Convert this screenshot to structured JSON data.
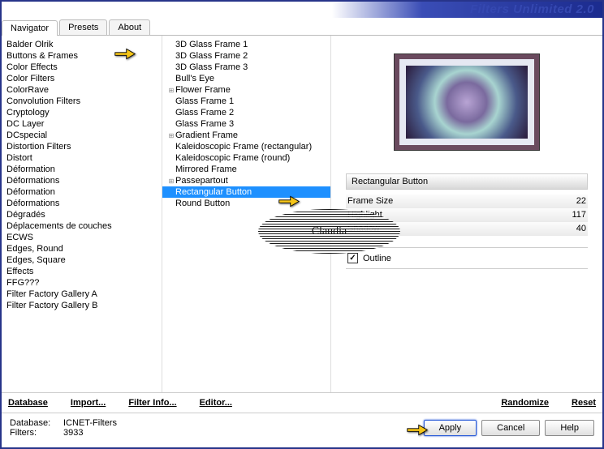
{
  "title": "Filters Unlimited 2.0",
  "tabs": [
    "Navigator",
    "Presets",
    "About"
  ],
  "categories": [
    "Balder Olrik",
    "Buttons & Frames",
    "Color Effects",
    "Color Filters",
    "ColorRave",
    "Convolution Filters",
    "Cryptology",
    "DC Layer",
    "DCspecial",
    "Distortion Filters",
    "Distort",
    "Déformation",
    "Déformations",
    "Déformation",
    "Déformations",
    "Dégradés",
    "Déplacements de couches",
    "ECWS",
    "Edges, Round",
    "Edges, Square",
    "Effects",
    "FFG???",
    "Filter Factory Gallery A",
    "Filter Factory Gallery B"
  ],
  "filters": [
    {
      "n": "3D Glass Frame 1",
      "g": 0
    },
    {
      "n": "3D Glass Frame 2",
      "g": 0
    },
    {
      "n": "3D Glass Frame 3",
      "g": 0
    },
    {
      "n": "Bull's Eye",
      "g": 0
    },
    {
      "n": "Flower Frame",
      "g": 1
    },
    {
      "n": "Glass Frame 1",
      "g": 0
    },
    {
      "n": "Glass Frame 2",
      "g": 0
    },
    {
      "n": "Glass Frame 3",
      "g": 0
    },
    {
      "n": "Gradient Frame",
      "g": 1
    },
    {
      "n": "Kaleidoscopic Frame (rectangular)",
      "g": 0
    },
    {
      "n": "Kaleidoscopic Frame (round)",
      "g": 0
    },
    {
      "n": "Mirrored Frame",
      "g": 0
    },
    {
      "n": "Passepartout",
      "g": 1
    },
    {
      "n": "Rectangular Button",
      "g": 0,
      "sel": 1
    },
    {
      "n": "Round Button",
      "g": 0
    }
  ],
  "selected_filter_name": "Rectangular Button",
  "sliders": [
    {
      "label": "Frame Size",
      "value": "22"
    },
    {
      "label": "Highlight",
      "value": "117"
    },
    {
      "label": "Shadow",
      "value": "40"
    }
  ],
  "checkbox": {
    "label": "Outline",
    "checked": true
  },
  "links": {
    "database": "Database",
    "import": "Import...",
    "filterinfo": "Filter Info...",
    "editor": "Editor...",
    "randomize": "Randomize",
    "reset": "Reset"
  },
  "status": {
    "db_label": "Database:",
    "db_value": "ICNET-Filters",
    "flt_label": "Filters:",
    "flt_value": "3933"
  },
  "buttons": {
    "apply": "Apply",
    "cancel": "Cancel",
    "help": "Help"
  },
  "watermark": "Claudia"
}
